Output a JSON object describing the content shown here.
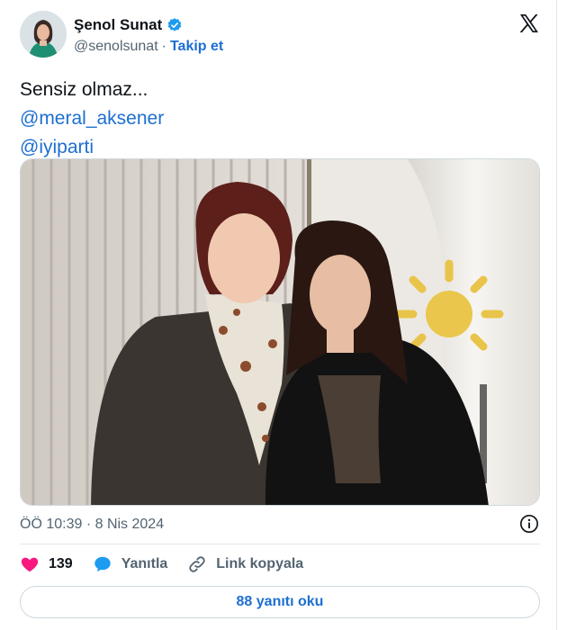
{
  "author": {
    "name": "Şenol Sunat",
    "handle": "@senolsunat",
    "follow_label": "Takip et",
    "separator": "·",
    "verified_icon": "verified-badge-icon"
  },
  "tweet": {
    "lines": [
      "Sensiz olmaz..."
    ],
    "mentions": [
      "@meral_aksener",
      "@iyiparti"
    ],
    "timestamp": "ÖÖ 10:39 · 8 Nis 2024"
  },
  "actions": {
    "like_count": "139",
    "reply_label": "Yanıtla",
    "copy_link_label": "Link kopyala"
  },
  "replies_button": "88 yanıtı oku",
  "colors": {
    "link": "#1d6fd1",
    "like": "#f91880",
    "reply": "#1d9bf0",
    "muted": "#536471"
  }
}
